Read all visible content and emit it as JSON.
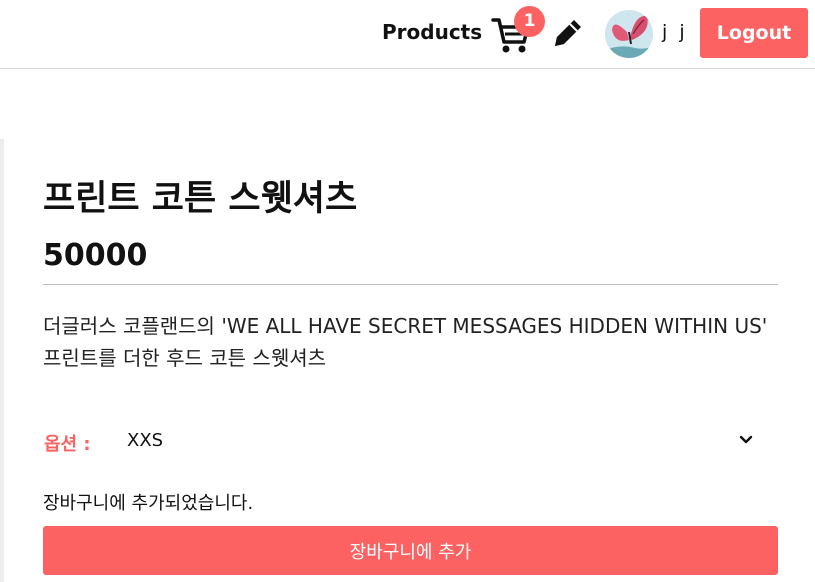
{
  "header": {
    "nav_products": "Products",
    "cart_count": "1",
    "username": "j j",
    "logout_label": "Logout"
  },
  "product": {
    "title": "프린트 코튼 스웻셔츠",
    "price": "50000",
    "description": "더글러스 코플랜드의 'WE ALL HAVE SECRET MESSAGES HIDDEN WITHIN US' 프린트를 더한 후드 코튼 스웻셔츠"
  },
  "options": {
    "label": "옵션 :",
    "selected": "XXS"
  },
  "cart_message": "장바구니에 추가되었습니다.",
  "add_to_cart_label": "장바구니에 추가",
  "icons": {
    "cart": "cart-icon",
    "edit": "pencil-icon",
    "avatar": "butterfly-avatar",
    "dropdown": "chevron-down-icon"
  },
  "colors": {
    "accent": "#fd6262",
    "text": "#111111"
  }
}
